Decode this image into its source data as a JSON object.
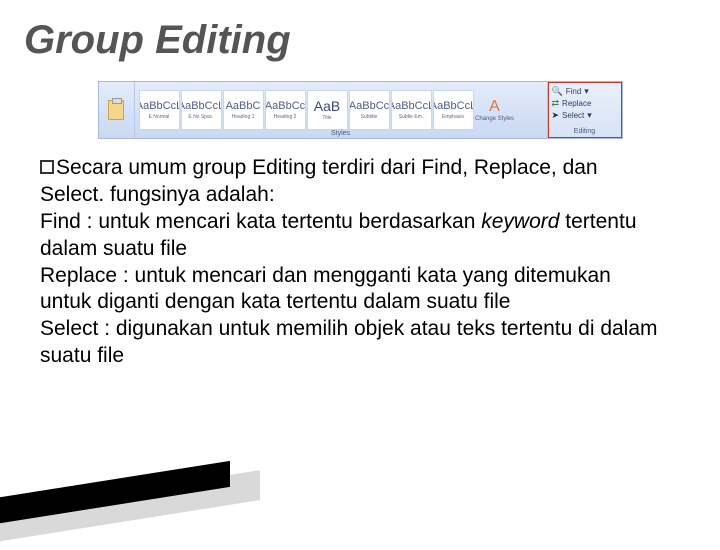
{
  "title": "Group Editing",
  "ribbon": {
    "styles_caption": "Styles",
    "style_boxes": [
      {
        "sample": "AaBbCcL",
        "name": "E Normal"
      },
      {
        "sample": "AaBbCcL",
        "name": "E No Spac."
      },
      {
        "sample": "AaBbC",
        "name": "Heading 1"
      },
      {
        "sample": "AaBbCc",
        "name": "Heading 2"
      },
      {
        "sample": "AaB",
        "name": "Title"
      },
      {
        "sample": "AaBbCc",
        "name": "Subtitle"
      },
      {
        "sample": "AaBbCcL",
        "name": "Subtle Em."
      },
      {
        "sample": "AaBbCcL",
        "name": "Emphasis"
      }
    ],
    "change_styles": "Change Styles",
    "editing": {
      "find": "Find",
      "replace": "Replace",
      "select": "Select",
      "label": "Editing"
    }
  },
  "body": {
    "p1a": "Secara umum group Editing terdiri dari Find, Replace, dan Select. fungsinya adalah:",
    "p2a": "Find : untuk mencari kata tertentu berdasarkan ",
    "p2b": "keyword",
    "p2c": " tertentu dalam suatu file",
    "p3": "Replace : untuk mencari dan mengganti kata yang ditemukan untuk diganti dengan kata tertentu dalam suatu file",
    "p4": "Select : digunakan untuk memilih objek atau teks tertentu di dalam suatu file"
  }
}
